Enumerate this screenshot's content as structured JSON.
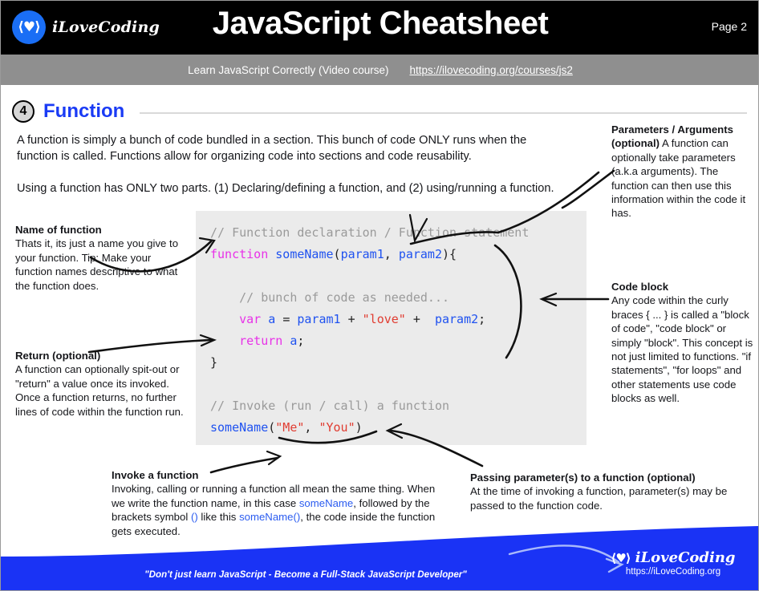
{
  "header": {
    "logo_mark": "⟨♥⟩",
    "logo_text": "iLoveCoding",
    "title": "JavaScript Cheatsheet",
    "page_label": "Page 2",
    "sub_label": "Learn JavaScript Correctly (Video course)",
    "sub_link": "https://ilovecoding.org/courses/js2",
    "bar_color": "#000000",
    "sub_bar_color": "#8f8f8f",
    "accent_color": "#1a6ef5"
  },
  "section": {
    "number": "4",
    "title": "Function",
    "title_color": "#1a3bf5"
  },
  "intro": {
    "paragraph1": "A function is simply a bunch of code bundled in a section. This bunch of code ONLY runs when the function is called. Functions allow for organizing code into sections and code reusability.",
    "paragraph2": "Using a function has ONLY two parts. (1) Declaring/defining a function, and (2) using/running a function."
  },
  "code": {
    "background": "#ebebeb",
    "lines": [
      "// Function declaration / Function statement",
      "function someName(param1, param2){",
      "",
      "    // bunch of code as needed...",
      "    var a = param1 + \"love\" +  param2;",
      "    return a;",
      "}",
      "",
      "// Invoke (run / call) a function",
      "someName(\"Me\", \"You\")"
    ],
    "colors": {
      "comment": "#9a9a9a",
      "keyword": "#e832e8",
      "identifier": "#1f52f0",
      "string": "#e03c31",
      "plain": "#222222"
    }
  },
  "annotations": {
    "params": {
      "title": "Parameters / Arguments (optional)",
      "body": "A function can optionally take parameters (a.k.a arguments). The function can then use this information within the code it has."
    },
    "code_block": {
      "title": "Code block",
      "body": "Any code within the curly braces { ... } is called a \"block of code\", \"code block\" or simply \"block\". This concept is not just limited to functions. \"if statements\", \"for loops\" and other statements use code blocks as well."
    },
    "name_of_function": {
      "title": "Name of function",
      "body": "Thats it, its just a name you give to your function. Tip: Make your function names descriptive to what the function does."
    },
    "return": {
      "title": "Return (optional)",
      "body": "A function can optionally spit-out or \"return\" a value once its invoked. Once a function returns, no further lines of code within the function run."
    },
    "invoke": {
      "title": "Invoke a function",
      "body_part1": "Invoking, calling or running a function all mean the same thing. When we write the function name, in this case ",
      "code1": "someName",
      "body_part2": ", followed by the brackets symbol ",
      "code2": "()",
      "body_part3": " like this ",
      "code3": "someName()",
      "body_part4": ", the code inside the function gets executed."
    },
    "passing": {
      "title": "Passing parameter(s) to a function (optional)",
      "body": "At the time of invoking a function, parameter(s) may be passed to the function code."
    }
  },
  "footer": {
    "tagline": "\"Don't just learn JavaScript - Become a Full-Stack JavaScript Developer\"",
    "logo_mark": "⟨♥⟩",
    "logo_text": "iLoveCoding",
    "url": "https://iLoveCoding.org",
    "band_color": "#1a33f5"
  }
}
